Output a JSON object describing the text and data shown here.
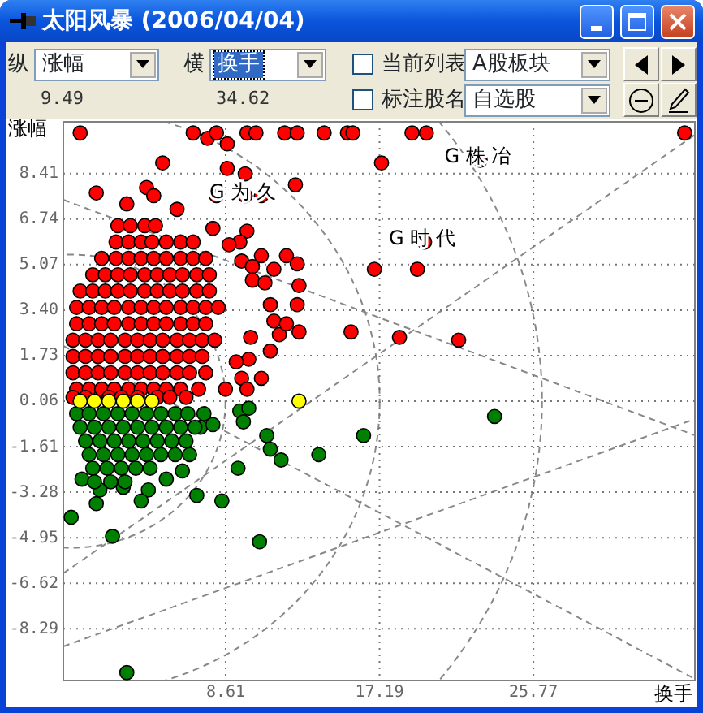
{
  "window": {
    "title": "太阳风暴 (2006/04/04)"
  },
  "toolbar": {
    "vertical_label": "纵",
    "vertical_select": {
      "value": "涨幅",
      "focused": false
    },
    "horizontal_label": "横",
    "horizontal_select": {
      "value": "换手",
      "focused": true
    },
    "checkboxes": [
      {
        "label": "当前列表",
        "checked": false
      },
      {
        "label": "标注股名",
        "checked": false
      }
    ],
    "list_selects": [
      {
        "value": "A股板块",
        "focused": false
      },
      {
        "value": "自选股",
        "focused": false
      }
    ],
    "readings": [
      "9.49",
      "34.62"
    ]
  },
  "chart": {
    "chart_data": {
      "type": "scatter",
      "grid": true,
      "xlabel": "换手",
      "ylabel": "涨幅",
      "xlim": [
        -0.44,
        34.77
      ],
      "ylim": [
        -10.19,
        10.31
      ],
      "xticks": [
        {
          "value": 8.61,
          "label": "8.61"
        },
        {
          "value": 17.19,
          "label": "17.19"
        },
        {
          "value": 25.77,
          "label": "25.77"
        }
      ],
      "yticks": [
        {
          "value": 8.41,
          "label": "8.41"
        },
        {
          "value": 6.74,
          "label": "6.74"
        },
        {
          "value": 5.07,
          "label": "5.07"
        },
        {
          "value": 3.4,
          "label": "3.40"
        },
        {
          "value": 1.73,
          "label": "1.73"
        },
        {
          "value": 0.06,
          "label": "0.06"
        },
        {
          "value": -1.61,
          "label": "-1.61"
        },
        {
          "value": -3.28,
          "label": "-3.28"
        },
        {
          "value": -4.95,
          "label": "-4.95"
        },
        {
          "value": -6.62,
          "label": "-6.62"
        },
        {
          "value": -8.29,
          "label": "-8.29"
        }
      ],
      "series": [
        {
          "color": "#ff0000",
          "x": [
            0.5,
            6.8,
            7.6,
            8.1,
            8.7,
            9.8,
            10.3,
            11.9,
            12.6,
            14.1,
            15.4,
            15.7,
            19.0,
            19.8,
            34.2,
            5.1,
            8.7,
            9.7,
            17.3,
            22.8,
            1.4,
            4.2,
            4.6,
            8.1,
            9.7,
            10.6,
            12.5,
            3.1,
            5.9,
            7.9,
            9.8,
            9.4,
            8.8,
            12.0,
            19.7,
            16.9,
            19.3,
            15.6,
            18.3,
            21.6,
            10.6,
            9.5,
            10.1,
            11.3,
            10.1,
            10.8,
            11.1,
            12.6,
            12.7,
            12.6,
            11.3,
            10.0,
            11.6,
            12.7,
            12.0,
            11.1,
            9.9,
            10.6,
            9.5,
            8.6,
            9.8,
            9.2,
            2.6,
            3.3,
            4.1,
            4.7,
            2.5,
            3.2,
            3.9,
            4.5,
            5.3,
            6.1,
            6.8,
            1.7,
            2.5,
            3.2,
            3.9,
            4.6,
            5.3,
            6.1,
            6.8,
            7.5,
            1.2,
            1.9,
            2.6,
            3.3,
            4.1,
            4.8,
            5.5,
            6.2,
            7.0,
            7.7,
            0.5,
            1.2,
            1.9,
            2.6,
            3.3,
            4.1,
            4.8,
            5.5,
            6.2,
            7.0,
            7.7,
            0.3,
            1.0,
            1.7,
            2.4,
            3.2,
            3.9,
            4.6,
            5.3,
            6.1,
            6.8,
            7.5,
            8.2,
            0.3,
            1.0,
            1.7,
            2.4,
            3.2,
            3.9,
            4.6,
            5.3,
            6.1,
            6.8,
            7.5,
            0.1,
            0.8,
            1.5,
            2.2,
            3.0,
            3.7,
            4.4,
            5.1,
            5.9,
            6.6,
            7.3,
            8.0,
            0.1,
            0.8,
            1.5,
            2.2,
            3.0,
            3.7,
            4.4,
            5.1,
            5.9,
            6.6,
            7.3,
            0.1,
            0.8,
            1.5,
            2.2,
            3.0,
            3.7,
            4.4,
            5.1,
            5.9,
            6.6,
            7.5,
            0.3,
            1.0,
            1.7,
            2.4,
            3.2,
            3.9,
            4.6,
            5.3,
            6.1,
            7.1,
            0.1,
            0.8,
            2.1,
            2.8,
            3.7,
            4.8,
            5.5,
            6.4
          ],
          "values": [
            9.9,
            9.9,
            9.7,
            9.9,
            9.5,
            9.9,
            9.9,
            9.9,
            9.9,
            9.9,
            9.9,
            9.9,
            9.9,
            9.9,
            9.9,
            8.8,
            8.6,
            8.4,
            8.8,
            8.9,
            7.7,
            7.9,
            7.6,
            7.6,
            7.6,
            7.6,
            8.0,
            7.3,
            7.1,
            6.4,
            6.3,
            5.9,
            5.8,
            5.4,
            5.9,
            4.9,
            4.9,
            2.6,
            2.4,
            2.3,
            5.4,
            5.2,
            5.0,
            4.9,
            4.5,
            4.4,
            3.6,
            3.6,
            4.3,
            5.1,
            3.0,
            2.4,
            2.5,
            2.6,
            2.9,
            1.9,
            1.6,
            0.9,
            0.9,
            0.5,
            0.5,
            1.5,
            6.5,
            6.5,
            6.5,
            6.5,
            5.9,
            5.9,
            5.9,
            5.9,
            5.9,
            5.9,
            5.9,
            5.3,
            5.3,
            5.3,
            5.3,
            5.3,
            5.3,
            5.3,
            5.3,
            5.3,
            4.7,
            4.7,
            4.7,
            4.7,
            4.7,
            4.7,
            4.7,
            4.7,
            4.7,
            4.7,
            4.1,
            4.1,
            4.1,
            4.1,
            4.1,
            4.1,
            4.1,
            4.1,
            4.1,
            4.1,
            4.1,
            3.5,
            3.5,
            3.5,
            3.5,
            3.5,
            3.5,
            3.5,
            3.5,
            3.5,
            3.5,
            3.5,
            3.5,
            2.9,
            2.9,
            2.9,
            2.9,
            2.9,
            2.9,
            2.9,
            2.9,
            2.9,
            2.9,
            2.9,
            2.3,
            2.3,
            2.3,
            2.3,
            2.3,
            2.3,
            2.3,
            2.3,
            2.3,
            2.3,
            2.3,
            2.3,
            1.7,
            1.7,
            1.7,
            1.7,
            1.7,
            1.7,
            1.7,
            1.7,
            1.7,
            1.7,
            1.7,
            1.1,
            1.1,
            1.1,
            1.1,
            1.1,
            1.1,
            1.1,
            1.1,
            1.1,
            1.1,
            1.1,
            0.5,
            0.5,
            0.5,
            0.5,
            0.5,
            0.5,
            0.5,
            0.5,
            0.5,
            0.5,
            0.2,
            0.2,
            0.2,
            0.2,
            0.2,
            0.2,
            0.2,
            0.2
          ]
        },
        {
          "color": "#008000",
          "x": [
            9.4,
            9.9,
            9.6,
            7.2,
            7.9,
            10.9,
            11.1,
            11.7,
            13.8,
            9.3,
            5.3,
            7.0,
            8.4,
            4.3,
            3.9,
            1.4,
            0.0,
            2.3,
            10.5,
            3.1,
            6.6,
            6.2,
            2.9,
            1.6,
            0.6,
            16.3,
            23.6,
            0.3,
            1.0,
            1.8,
            2.6,
            3.4,
            4.2,
            5.0,
            5.8,
            6.5,
            7.4,
            0.5,
            1.3,
            2.1,
            2.9,
            3.7,
            4.5,
            5.3,
            6.1,
            6.9,
            0.8,
            1.6,
            2.4,
            3.2,
            4.0,
            4.8,
            5.6,
            6.4,
            1.0,
            1.8,
            2.6,
            3.4,
            4.2,
            5.0,
            5.8,
            1.2,
            2.0,
            2.8,
            3.6,
            4.4,
            1.3,
            2.2,
            3.0
          ],
          "values": [
            -0.3,
            -0.2,
            -0.7,
            -0.9,
            -0.8,
            -1.2,
            -1.7,
            -2.1,
            -1.9,
            -2.4,
            -2.8,
            -3.4,
            -3.6,
            -3.2,
            -3.6,
            -3.7,
            -4.2,
            -4.9,
            -5.1,
            -9.9,
            -1.9,
            -2.5,
            -3.1,
            -3.2,
            -2.8,
            -1.2,
            -0.5,
            -0.4,
            -0.4,
            -0.4,
            -0.4,
            -0.4,
            -0.4,
            -0.4,
            -0.4,
            -0.4,
            -0.4,
            -0.9,
            -0.9,
            -0.9,
            -0.9,
            -0.9,
            -0.9,
            -0.9,
            -0.9,
            -0.9,
            -1.4,
            -1.4,
            -1.4,
            -1.4,
            -1.4,
            -1.4,
            -1.4,
            -1.4,
            -1.9,
            -1.9,
            -1.9,
            -1.9,
            -1.9,
            -1.9,
            -1.9,
            -2.4,
            -2.4,
            -2.4,
            -2.4,
            -2.4,
            -2.9,
            -2.9,
            -2.9
          ]
        },
        {
          "color": "#ffff00",
          "x": [
            0.5,
            1.3,
            2.1,
            2.9,
            3.7,
            4.5,
            12.7
          ],
          "values": [
            0.06,
            0.06,
            0.06,
            0.06,
            0.06,
            0.06,
            0.06
          ]
        }
      ],
      "annotations": [
        {
          "x": 9.7,
          "y": 7.6,
          "text": "G 为 久"
        },
        {
          "x": 22.8,
          "y": 8.9,
          "text": "G 株 冶"
        },
        {
          "x": 19.7,
          "y": 5.9,
          "text": "G 时 代"
        }
      ]
    }
  }
}
